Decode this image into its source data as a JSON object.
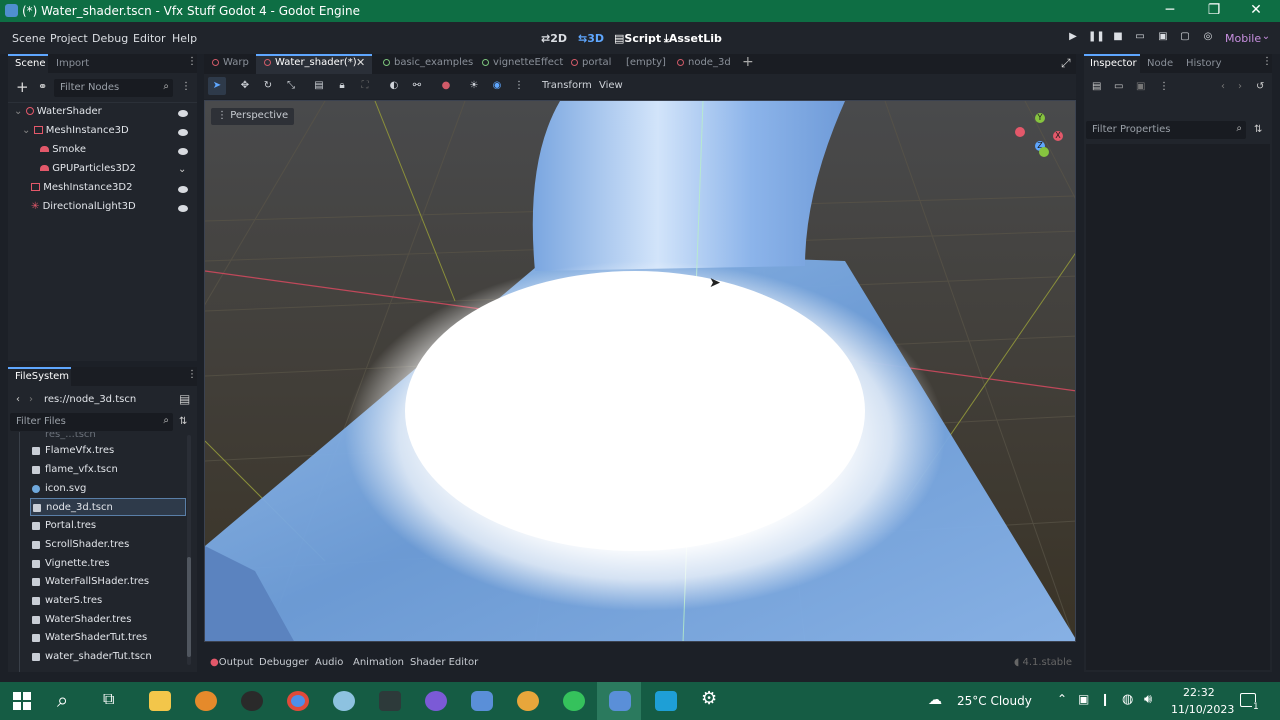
{
  "window": {
    "title": "(*) Water_shader.tscn - Vfx Stuff Godot 4 - Godot Engine",
    "minimize": "─",
    "maximize": "❐",
    "close": "✕"
  },
  "menubar": {
    "menus": [
      "Scene",
      "Project",
      "Debug",
      "Editor",
      "Help"
    ],
    "main_screens": [
      "2D",
      "3D",
      "Script",
      "AssetLib"
    ],
    "renderer": "Mobile"
  },
  "scene_dock": {
    "tabs": [
      "Scene",
      "Import"
    ],
    "filter_placeholder": "Filter Nodes",
    "nodes": [
      "WaterShader",
      "MeshInstance3D",
      "Smoke",
      "GPUParticles3D2",
      "MeshInstance3D2",
      "DirectionalLight3D"
    ]
  },
  "filesystem": {
    "title": "FileSystem",
    "path": "res://node_3d.tscn",
    "filter_placeholder": "Filter Files",
    "files": [
      "FlameVfx.tres",
      "flame_vfx.tscn",
      "icon.svg",
      "node_3d.tscn",
      "Portal.tres",
      "ScrollShader.tres",
      "Vignette.tres",
      "WaterFallSHader.tres",
      "waterS.tres",
      "WaterShader.tres",
      "WaterShaderTut.tres",
      "water_shaderTut.tscn"
    ],
    "selected": "node_3d.tscn"
  },
  "editor_tabs": [
    "Warp",
    "Water_shader(*)",
    "basic_examples",
    "vignetteEffect",
    "portal",
    "[empty]",
    "node_3d"
  ],
  "viewport_menu": {
    "transform": "Transform",
    "view": "View",
    "perspective": "Perspective"
  },
  "gizmo": {
    "x": "X",
    "y": "Y",
    "z": "Z"
  },
  "bottom_panel": {
    "tabs": [
      "Output",
      "Debugger",
      "Audio",
      "Animation",
      "Shader Editor"
    ],
    "version": "4.1.stable"
  },
  "inspector": {
    "tabs": [
      "Inspector",
      "Node",
      "History"
    ],
    "filter_placeholder": "Filter Properties"
  },
  "taskbar": {
    "weather": "25°C  Cloudy",
    "time": "22:32",
    "date": "11/10/2023",
    "notifications": "1"
  },
  "colors": {
    "accent": "#5fa7ff",
    "titlebar": "#0e6e44",
    "taskbar": "#155c44"
  }
}
